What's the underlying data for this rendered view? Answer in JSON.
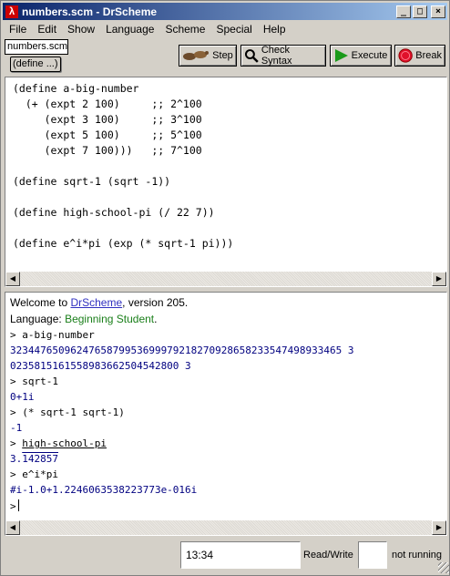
{
  "window": {
    "title": "numbers.scm - DrScheme",
    "icon": "lambda-icon"
  },
  "menu": [
    "File",
    "Edit",
    "Show",
    "Language",
    "Scheme",
    "Special",
    "Help"
  ],
  "toolbar": {
    "file_tab": "numbers.scm",
    "define_popup": "(define ...)",
    "step_label": "Step",
    "check_syntax_label": "Check Syntax",
    "execute_label": "Execute",
    "break_label": "Break"
  },
  "editor": {
    "lines": [
      "(define a-big-number",
      "  (+ (expt 2 100)     ;; 2^100",
      "     (expt 3 100)     ;; 3^100",
      "     (expt 5 100)     ;; 5^100",
      "     (expt 7 100)))   ;; 7^100",
      "",
      "(define sqrt-1 (sqrt -1))",
      "",
      "(define high-school-pi (/ 22 7))",
      "",
      "(define e^i*pi (exp (* sqrt-1 pi)))"
    ]
  },
  "interactions": {
    "welcome_prefix": "Welcome to ",
    "welcome_link": "DrScheme",
    "welcome_suffix": ", version 205.",
    "language_prefix": "Language: ",
    "language_name": "Beginning Student",
    "language_suffix": ".",
    "prompt": ">",
    "entries": [
      {
        "input": "a-big-number",
        "output_1": "3234476509624765879953699979218270928658233547498933465 3",
        "output_2": "0235815161558983662504542800 3"
      },
      {
        "input": "sqrt-1",
        "output": "0+1i"
      },
      {
        "input": "(* sqrt-1 sqrt-1)",
        "output": "-1"
      },
      {
        "input": "high-school-pi",
        "output_whole": "3.",
        "output_repeat": "142857"
      },
      {
        "input": "e^i*pi",
        "output": "#i-1.0+1.2246063538223773e-016i"
      }
    ]
  },
  "status": {
    "position": "13:34",
    "mode": "Read/Write",
    "running": "not running"
  }
}
